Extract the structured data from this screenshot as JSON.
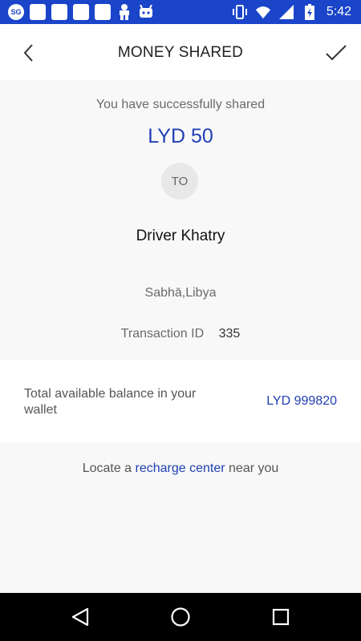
{
  "status_bar": {
    "left_badge": "SG",
    "time": "5:42",
    "icons": [
      "sg-badge-icon",
      "notification-icon",
      "notification-icon",
      "notification-icon",
      "notification-icon",
      "android-icon",
      "bug-icon",
      "vibrate-icon",
      "wifi-icon",
      "signal-icon",
      "battery-icon"
    ]
  },
  "header": {
    "title": "MONEY SHARED",
    "back_icon": "chevron-left-icon",
    "confirm_icon": "checkmark-icon"
  },
  "summary": {
    "success_text": "You have successfully shared",
    "amount": "LYD 50",
    "to_label": "TO",
    "recipient_name": "Driver Khatry",
    "location": "Sabhā,Libya",
    "transaction_label": "Transaction ID",
    "transaction_id": "335"
  },
  "balance": {
    "label": "Total available balance in your wallet",
    "value": "LYD 999820"
  },
  "recharge": {
    "prefix": "Locate a ",
    "link_text": "recharge center",
    "suffix": " near you"
  },
  "colors": {
    "status_bar": "#1a45c9",
    "accent": "#1f3fb5",
    "background": "#f8f8f8",
    "nav_bar": "#000000"
  },
  "nav": {
    "back": "triangle-back-icon",
    "home": "circle-home-icon",
    "recents": "square-recents-icon"
  }
}
